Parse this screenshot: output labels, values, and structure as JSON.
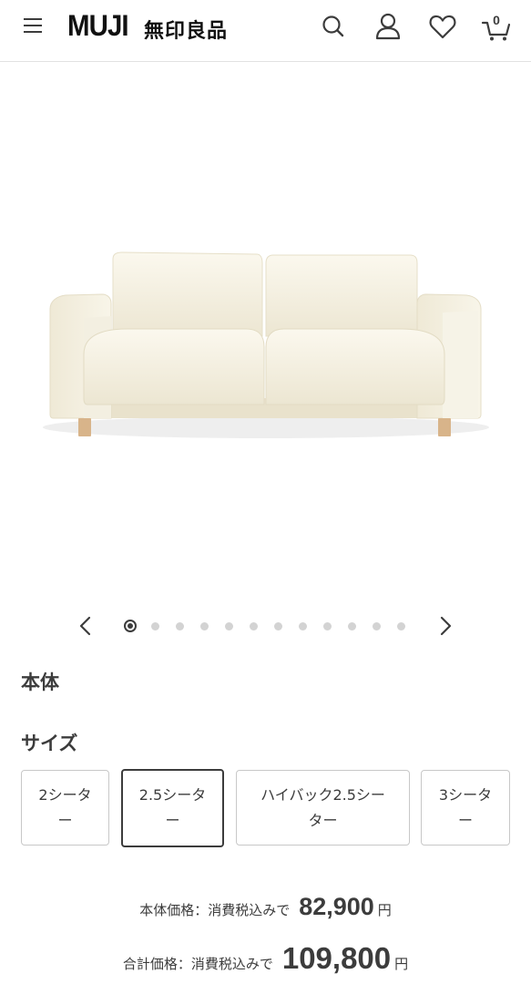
{
  "header": {
    "logo_en": "MUJI",
    "logo_jp": "無印良品",
    "cart_count": "0",
    "icons": [
      "menu-icon",
      "search-icon",
      "account-icon",
      "heart-icon",
      "cart-icon"
    ]
  },
  "product": {
    "image": "sofa-image",
    "carousel": {
      "current": 1,
      "total": 12
    }
  },
  "sections": {
    "body_title": "本体",
    "size_title": "サイズ"
  },
  "sizes": [
    {
      "label": "2シーター",
      "line1": "2シータ",
      "line2": "ー",
      "selected": false
    },
    {
      "label": "2.5シーター",
      "line1": "2.5シータ",
      "line2": "ー",
      "selected": true
    },
    {
      "label": "ハイバック2.5シーター",
      "line1": "ハイバック2.5シー",
      "line2": "ター",
      "selected": false
    },
    {
      "label": "3シーター",
      "line1": "3シータ",
      "line2": "ー",
      "selected": false
    }
  ],
  "prices": {
    "body_label": "本体価格：消費税込みで",
    "body_value": "82,900",
    "total_label": "合計価格：消費税込みで",
    "total_value": "109,800",
    "currency": "円"
  },
  "colors": {
    "text": "#3c3c3c",
    "border": "#c8c8c8",
    "dot": "#d3d3d3"
  }
}
